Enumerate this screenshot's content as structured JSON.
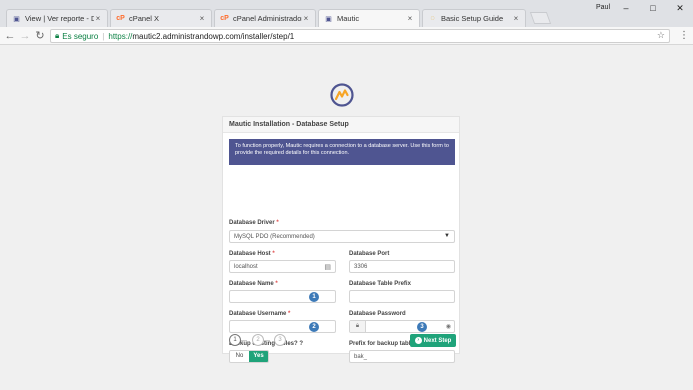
{
  "browser": {
    "tabs": [
      {
        "label": "View | Ver reporte - Dov"
      },
      {
        "label": "cPanel X"
      },
      {
        "label": "cPanel Administrador de"
      },
      {
        "label": "Mautic"
      },
      {
        "label": "Basic Setup Guide"
      }
    ],
    "user_name": "Paul",
    "address": {
      "secure_label": "Es seguro",
      "url_scheme": "https://",
      "url_rest": "mautic2.administrandowp.com/installer/step/1"
    }
  },
  "installer": {
    "title": "Mautic Installation - Database Setup",
    "alert": "To function properly, Mautic requires a connection to a database server. Use this form to provide the required details for this connection.",
    "fields": {
      "driver_label": "Database Driver",
      "driver_value": "MySQL PDO (Recommended)",
      "host_label": "Database Host",
      "host_value": "localhost",
      "port_label": "Database Port",
      "port_value": "3306",
      "name_label": "Database Name",
      "name_value": "",
      "prefix_label": "Database Table Prefix",
      "prefix_value": "",
      "user_label": "Database Username",
      "user_value": "",
      "password_label": "Database Password",
      "password_value": "",
      "backup_label": "Backup existing tables?",
      "backup_no": "No",
      "backup_yes": "Yes",
      "backup_prefix_label": "Prefix for backup tables",
      "backup_prefix_value": "bak_"
    },
    "markers": {
      "one": "1",
      "two": "2",
      "three": "3"
    },
    "steps": [
      "1",
      "2",
      "3"
    ],
    "next_label": "Next Step"
  },
  "colors": {
    "accent": "#1fa37a",
    "alert_bg": "#4f5591",
    "marker": "#3d7ab8"
  }
}
